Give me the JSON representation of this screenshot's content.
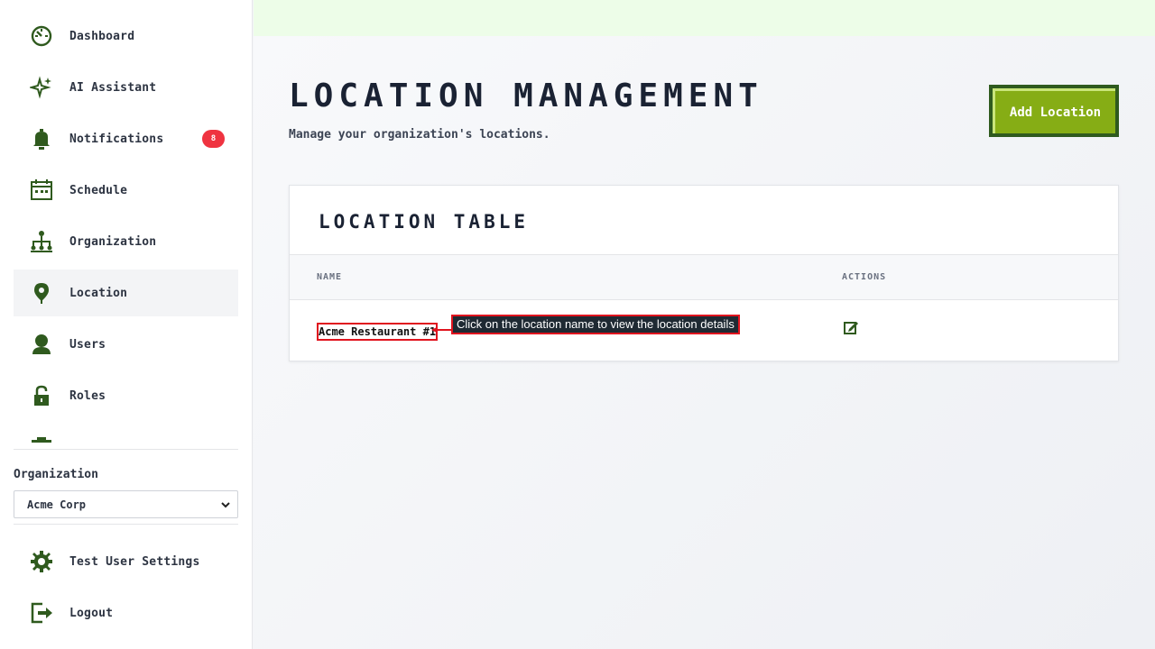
{
  "sidebar": {
    "items": [
      {
        "label": "Dashboard",
        "icon": "dashboard-icon"
      },
      {
        "label": "AI Assistant",
        "icon": "sparkle-icon"
      },
      {
        "label": "Notifications",
        "icon": "bell-icon",
        "badge": "8"
      },
      {
        "label": "Schedule",
        "icon": "calendar-icon"
      },
      {
        "label": "Organization",
        "icon": "org-chart-icon"
      },
      {
        "label": "Location",
        "icon": "location-pin-icon",
        "active": true
      },
      {
        "label": "Users",
        "icon": "user-icon"
      },
      {
        "label": "Roles",
        "icon": "lock-icon"
      }
    ],
    "org_label": "Organization",
    "org_selected": "Acme Corp",
    "settings_label": "Test User Settings",
    "logout_label": "Logout"
  },
  "page": {
    "title": "LOCATION MANAGEMENT",
    "subtitle": "Manage your organization's locations.",
    "add_button_label": "Add Location"
  },
  "table": {
    "title": "LOCATION TABLE",
    "columns": [
      "NAME",
      "ACTIONS"
    ],
    "rows": [
      {
        "name": "Acme Restaurant #1"
      }
    ]
  },
  "callout": {
    "text": "Click on the location name to view the location details"
  },
  "colors": {
    "icon_green": "#2f5a1e",
    "accent_green": "#86ad15",
    "badge_red": "#ef3340",
    "topbar": "#edfde8"
  }
}
